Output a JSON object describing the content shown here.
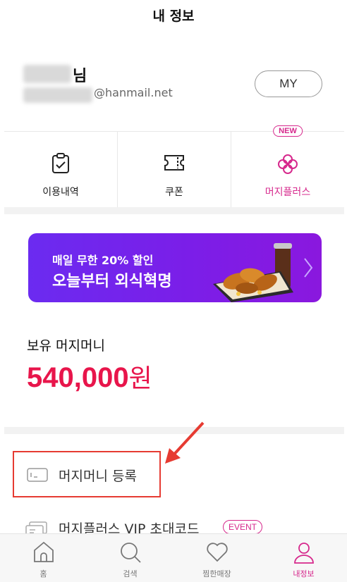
{
  "header": {
    "title": "내 정보"
  },
  "profile": {
    "name_suffix": "님",
    "email_suffix": "@hanmail.net",
    "my_button": "MY"
  },
  "menu": {
    "items": [
      {
        "label": "이용내역",
        "icon": "clipboard-check-icon"
      },
      {
        "label": "쿠폰",
        "icon": "ticket-icon"
      },
      {
        "label": "머지플러스",
        "icon": "plus-flower-icon",
        "badge": "NEW"
      }
    ],
    "accent_color": "#d6288c"
  },
  "banner": {
    "line1": "매일 무한 20% 할인",
    "line2": "오늘부터 외식혁명"
  },
  "money": {
    "label": "보유 머지머니",
    "amount": "540,000",
    "unit": "원",
    "color": "#e8154b"
  },
  "list": {
    "register_label": "머지머니 등록",
    "vip_label": "머지플러스 VIP 초대코드",
    "vip_badge": "EVENT"
  },
  "tabbar": {
    "tabs": [
      {
        "label": "홈",
        "icon": "home-icon"
      },
      {
        "label": "검색",
        "icon": "search-icon"
      },
      {
        "label": "찜한매장",
        "icon": "heart-icon"
      },
      {
        "label": "내정보",
        "icon": "person-icon",
        "active": true
      }
    ]
  }
}
